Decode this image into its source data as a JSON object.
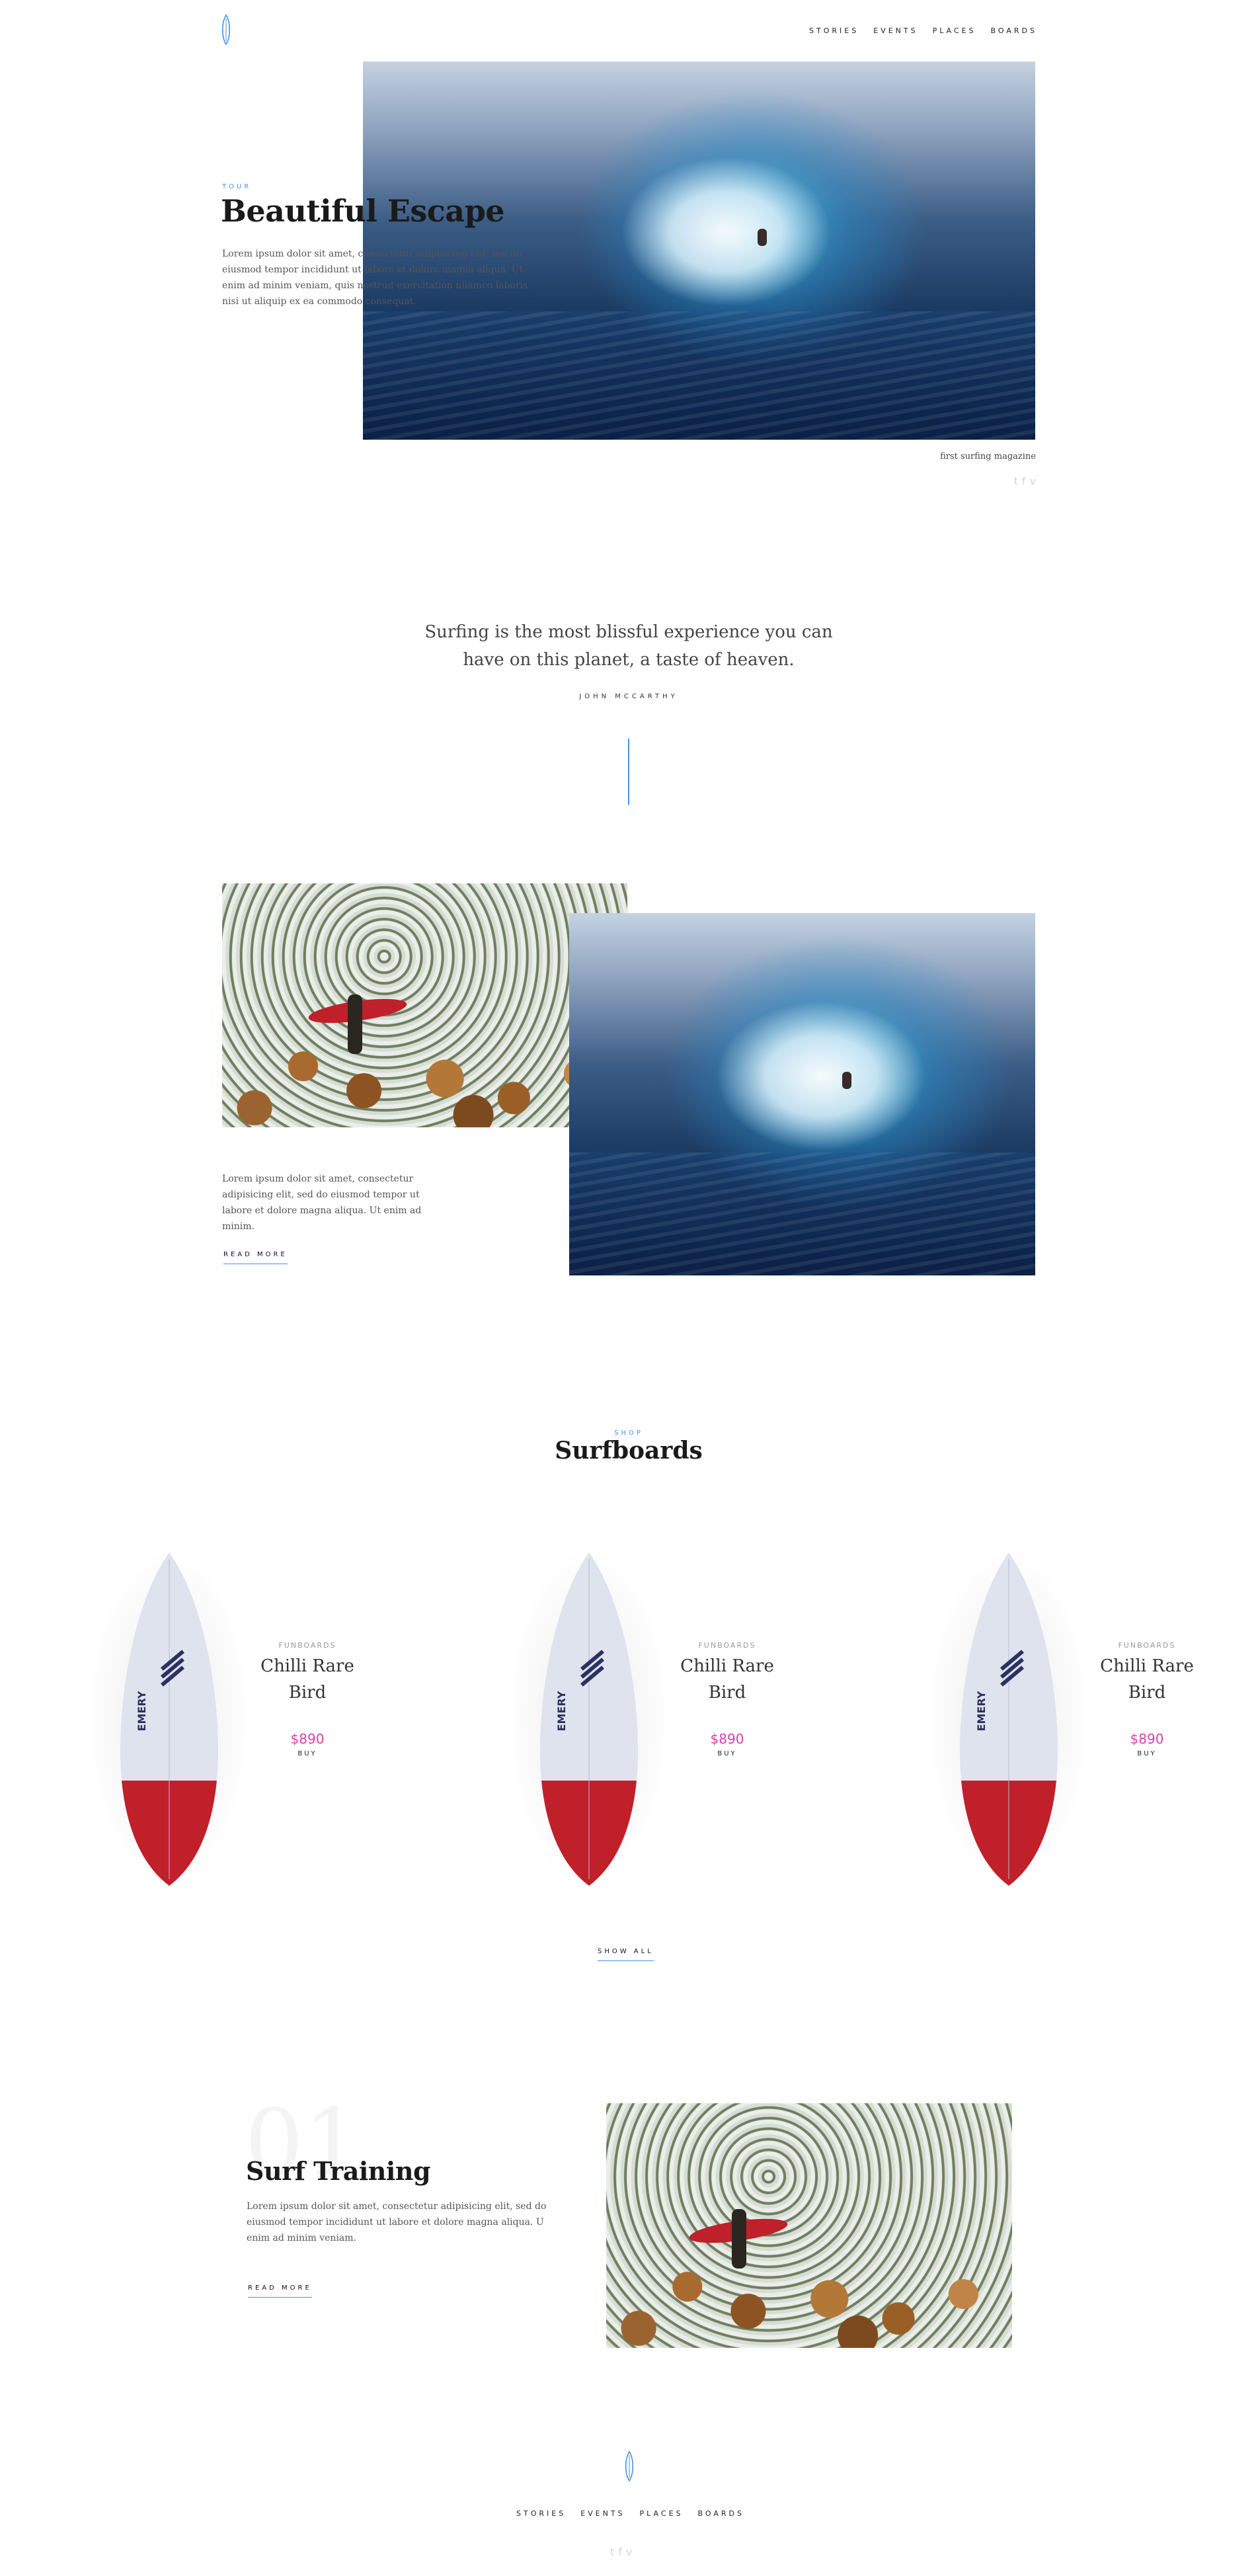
{
  "header": {
    "nav": [
      "STORIES",
      "EVENTS",
      "PLACES",
      "BOARDS"
    ]
  },
  "hero": {
    "kicker": "TOUR",
    "title": "Beautiful Escape",
    "body": "Lorem ipsum dolor sit amet, consectetur adipisicing elit, sed do eiusmod tempor incididunt ut labore et dolore magna aliqua. Ut enim ad minim veniam, quis nostrud exercitation ullamco laboris nisi ut aliquip ex ea commodo consequat.",
    "caption": "first surfing magazine",
    "social": [
      "t",
      "f",
      "v"
    ]
  },
  "quote": {
    "text_line1": "Surfing is the most blissful experience you can",
    "text_line2": "have on this planet, a taste of heaven.",
    "author": "JOHN MCCARTHY"
  },
  "story": {
    "body": "Lorem ipsum dolor sit amet, consectetur adipisicing elit, sed do eiusmod tempor ut labore et dolore magna aliqua. Ut enim ad minim.",
    "read_more": "READ MORE"
  },
  "shop": {
    "kicker": "SHOP",
    "title": "Surfboards",
    "show_all": "SHOW ALL",
    "products": [
      {
        "category": "FUNBOARDS",
        "name_line1": "Chilli Rare",
        "name_line2": "Bird",
        "price": "$890",
        "buy": "BUY",
        "brand": "EMERY"
      },
      {
        "category": "FUNBOARDS",
        "name_line1": "Chilli Rare",
        "name_line2": "Bird",
        "price": "$890",
        "buy": "BUY",
        "brand": "EMERY"
      },
      {
        "category": "FUNBOARDS",
        "name_line1": "Chilli Rare",
        "name_line2": "Bird",
        "price": "$890",
        "buy": "BUY",
        "brand": "EMERY"
      }
    ]
  },
  "training": {
    "number": "01",
    "title": "Surf Training",
    "body": "Lorem ipsum dolor sit amet, consectetur adipisicing elit, sed do eiusmod tempor incididunt ut labore et dolore magna aliqua. U enim ad minim veniam.",
    "read_more": "READ MORE"
  },
  "footer": {
    "nav": [
      "STORIES",
      "EVENTS",
      "PLACES",
      "BOARDS"
    ],
    "social": [
      "t",
      "f",
      "v"
    ]
  },
  "colors": {
    "accent": "#4a90e2",
    "price": "#d63fb0",
    "board_red": "#c0202a",
    "board_body": "#dfe3ee",
    "board_brand": "#2b3160"
  },
  "icons": {
    "logo": "surfboard-logo-icon",
    "social": [
      "twitter-icon",
      "facebook-icon",
      "vimeo-icon"
    ]
  }
}
